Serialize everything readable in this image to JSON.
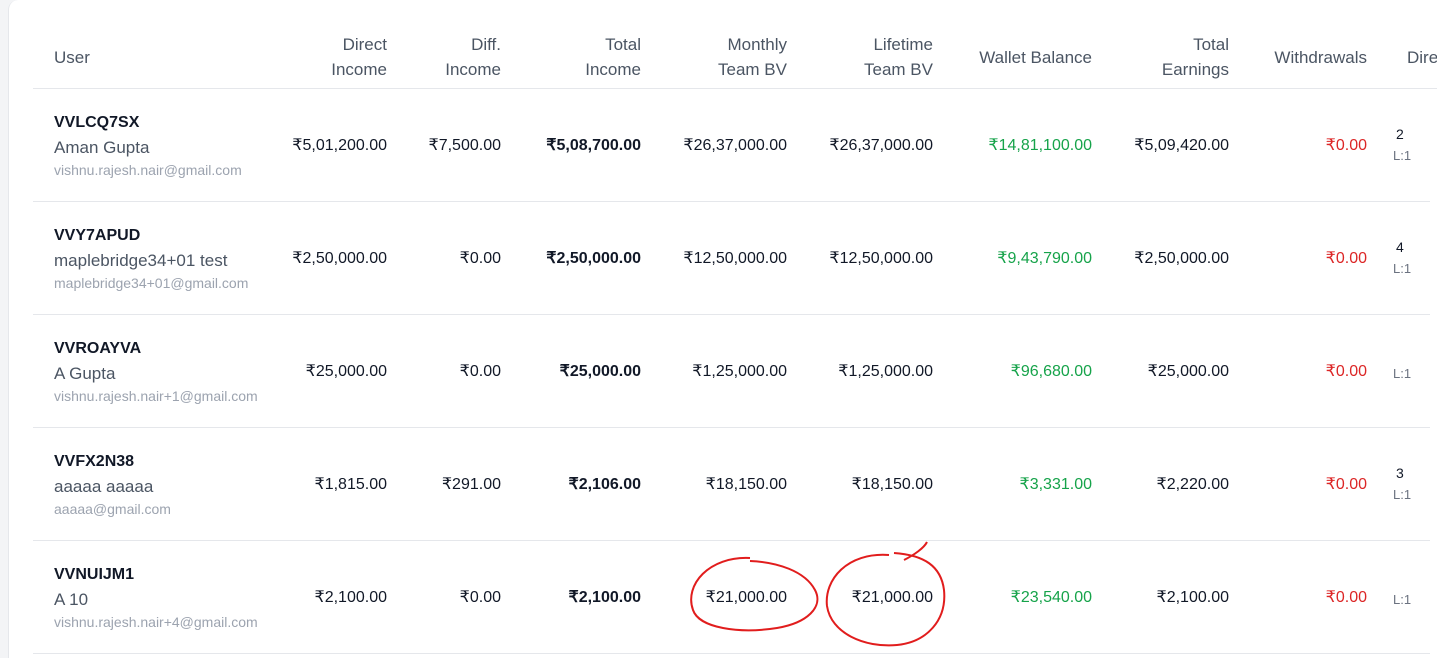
{
  "columns": [
    {
      "key": "user",
      "label": "User"
    },
    {
      "key": "direct_income",
      "label": "Direct Income"
    },
    {
      "key": "diff_income",
      "label": "Diff. Income"
    },
    {
      "key": "total_income",
      "label": "Total Income"
    },
    {
      "key": "monthly_team_bv",
      "label": "Monthly Team BV"
    },
    {
      "key": "lifetime_team_bv",
      "label": "Lifetime Team BV"
    },
    {
      "key": "wallet_balance",
      "label": "Wallet Balance"
    },
    {
      "key": "total_earnings",
      "label": "Total Earnings"
    },
    {
      "key": "withdrawals",
      "label": "Withdrawals"
    },
    {
      "key": "directs",
      "label": "Dire"
    }
  ],
  "header_lines": {
    "direct_income": [
      "Direct",
      "Income"
    ],
    "diff_income": [
      "Diff.",
      "Income"
    ],
    "total_income": [
      "Total",
      "Income"
    ],
    "monthly_team_bv": [
      "Monthly",
      "Team BV"
    ],
    "lifetime_team_bv": [
      "Lifetime",
      "Team BV"
    ],
    "total_earnings": [
      "Total",
      "Earnings"
    ]
  },
  "rows": [
    {
      "id": "VVLCQ7SX",
      "name": "Aman Gupta",
      "email": "vishnu.rajesh.nair@gmail.com",
      "direct_income": "₹5,01,200.00",
      "diff_income": "₹7,500.00",
      "total_income": "₹5,08,700.00",
      "monthly_team_bv": "₹26,37,000.00",
      "lifetime_team_bv": "₹26,37,000.00",
      "wallet_balance": "₹14,81,100.00",
      "total_earnings": "₹5,09,420.00",
      "withdrawals": "₹0.00",
      "dir_top": "2",
      "dir_sub": "L:1"
    },
    {
      "id": "VVY7APUD",
      "name": "maplebridge34+01 test",
      "email": "maplebridge34+01@gmail.com",
      "direct_income": "₹2,50,000.00",
      "diff_income": "₹0.00",
      "total_income": "₹2,50,000.00",
      "monthly_team_bv": "₹12,50,000.00",
      "lifetime_team_bv": "₹12,50,000.00",
      "wallet_balance": "₹9,43,790.00",
      "total_earnings": "₹2,50,000.00",
      "withdrawals": "₹0.00",
      "dir_top": "4",
      "dir_sub": "L:1"
    },
    {
      "id": "VVROAYVA",
      "name": "A Gupta",
      "email": "vishnu.rajesh.nair+1@gmail.com",
      "direct_income": "₹25,000.00",
      "diff_income": "₹0.00",
      "total_income": "₹25,000.00",
      "monthly_team_bv": "₹1,25,000.00",
      "lifetime_team_bv": "₹1,25,000.00",
      "wallet_balance": "₹96,680.00",
      "total_earnings": "₹25,000.00",
      "withdrawals": "₹0.00",
      "dir_top": "",
      "dir_sub": "L:1"
    },
    {
      "id": "VVFX2N38",
      "name": "aaaaa aaaaa",
      "email": "aaaaa@gmail.com",
      "direct_income": "₹1,815.00",
      "diff_income": "₹291.00",
      "total_income": "₹2,106.00",
      "monthly_team_bv": "₹18,150.00",
      "lifetime_team_bv": "₹18,150.00",
      "wallet_balance": "₹3,331.00",
      "total_earnings": "₹2,220.00",
      "withdrawals": "₹0.00",
      "dir_top": "3",
      "dir_sub": "L:1"
    },
    {
      "id": "VVNUIJM1",
      "name": "A 10",
      "email": "vishnu.rajesh.nair+4@gmail.com",
      "direct_income": "₹2,100.00",
      "diff_income": "₹0.00",
      "total_income": "₹2,100.00",
      "monthly_team_bv": "₹21,000.00",
      "lifetime_team_bv": "₹21,000.00",
      "wallet_balance": "₹23,540.00",
      "total_earnings": "₹2,100.00",
      "withdrawals": "₹0.00",
      "dir_top": "",
      "dir_sub": "L:1"
    }
  ],
  "colors": {
    "positive": "#16a34a",
    "negative": "#dc2626",
    "annotation": "#e11d1d"
  },
  "annotations": [
    {
      "type": "hand-drawn-circle",
      "target": "rows.4.monthly_team_bv"
    },
    {
      "type": "hand-drawn-circle",
      "target": "rows.4.lifetime_team_bv"
    }
  ]
}
